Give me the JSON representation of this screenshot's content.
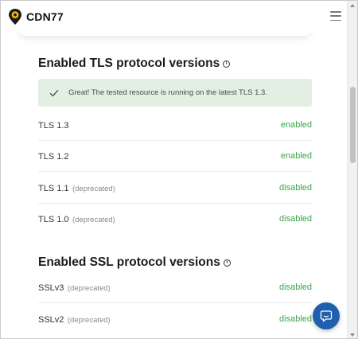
{
  "header": {
    "logo_text": "CDN77",
    "brand_color": "#f2c400"
  },
  "tls_section": {
    "title": "Enabled TLS protocol versions",
    "info_icon": "info-icon",
    "notice": "Great! The tested resource is running on the latest TLS 1.3.",
    "rows": [
      {
        "name": "TLS 1.3",
        "deprecated": "",
        "status": "enabled"
      },
      {
        "name": "TLS 1.2",
        "deprecated": "",
        "status": "enabled"
      },
      {
        "name": "TLS 1.1",
        "deprecated": "(deprecated)",
        "status": "disabled"
      },
      {
        "name": "TLS 1.0",
        "deprecated": "(deprecated)",
        "status": "disabled"
      }
    ]
  },
  "ssl_section": {
    "title": "Enabled SSL protocol versions",
    "info_icon": "info-icon",
    "rows": [
      {
        "name": "SSLv3",
        "deprecated": "(deprecated)",
        "status": "disabled"
      },
      {
        "name": "SSLv2",
        "deprecated": "(deprecated)",
        "status": "disabled"
      }
    ]
  },
  "colors": {
    "status_green": "#3aa54a",
    "notice_bg": "#e2efe2",
    "chat_button": "#1f5fae"
  },
  "icons": {
    "menu": "hamburger-menu-icon",
    "check": "check-icon",
    "chat": "chat-icon"
  }
}
